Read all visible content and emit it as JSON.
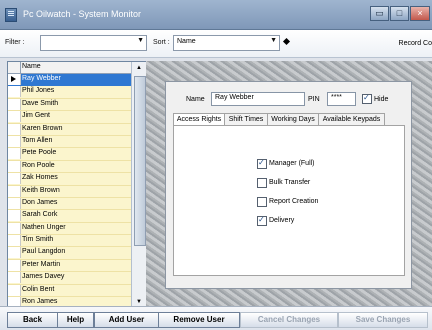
{
  "window": {
    "title": "Pc Oilwatch - System Monitor",
    "controls": [
      "▭",
      "□",
      "×"
    ]
  },
  "toolbar": {
    "filter_label": "Filter :",
    "filter_value": "",
    "sort_label": "Sort :",
    "sort_value": "Name",
    "record_text": "Record Co"
  },
  "list": {
    "header": "Name",
    "selected_index": 0,
    "items": [
      "Ray Webber",
      "Phil Jones",
      "Dave Smith",
      "Jim Gent",
      "Karen Brown",
      "Tom Allen",
      "Pete Poole",
      "Ron Poole",
      "Zak Homes",
      "Keith Brown",
      "Don James",
      "Sarah Cork",
      "Nathen Unger",
      "Tim Smith",
      "Paul Langdon",
      "Peter Martin",
      "James Davey",
      "Colin Bent",
      "Ron James"
    ]
  },
  "details": {
    "name_label": "Name",
    "name_value": "Ray Webber",
    "pin_label": "PIN",
    "pin_value": "****",
    "hide_label": "Hide",
    "hide_checked": true,
    "tabs": [
      "Access Rights",
      "Shift Times",
      "Working Days",
      "Available Keypads"
    ],
    "active_tab": 0,
    "rights": [
      {
        "label": "Manager (Full)",
        "checked": true
      },
      {
        "label": "Bulk Transfer",
        "checked": false
      },
      {
        "label": "Report Creation",
        "checked": false
      },
      {
        "label": "Delivery",
        "checked": true
      }
    ]
  },
  "buttons": {
    "back": "Back",
    "help": "Help",
    "add_user": "Add User",
    "remove_user": "Remove User",
    "cancel_changes": "Cancel Changes",
    "save_changes": "Save Changes"
  }
}
